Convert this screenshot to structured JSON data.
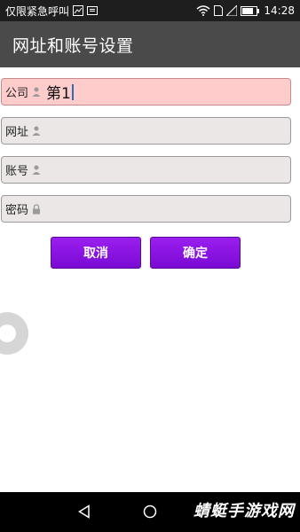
{
  "status_bar": {
    "carrier": "仅限紧急呼叫",
    "time": "14:28"
  },
  "app_bar": {
    "title": "网址和账号设置"
  },
  "form": {
    "fields": [
      {
        "label": "公司",
        "value": "第1",
        "icon": "person-icon"
      },
      {
        "label": "网址",
        "value": "",
        "icon": "person-icon"
      },
      {
        "label": "账号",
        "value": "",
        "icon": "person-icon"
      },
      {
        "label": "密码",
        "value": "",
        "icon": "lock-icon"
      }
    ]
  },
  "buttons": {
    "cancel_label": "取消",
    "confirm_label": "确定"
  },
  "watermark": {
    "text": "蜻蜓手游戏网"
  },
  "colors": {
    "app_bar": "#4a4a4a",
    "active_field": "#ffcccc",
    "field": "#ebe7e7",
    "button": "#8a14e6"
  }
}
